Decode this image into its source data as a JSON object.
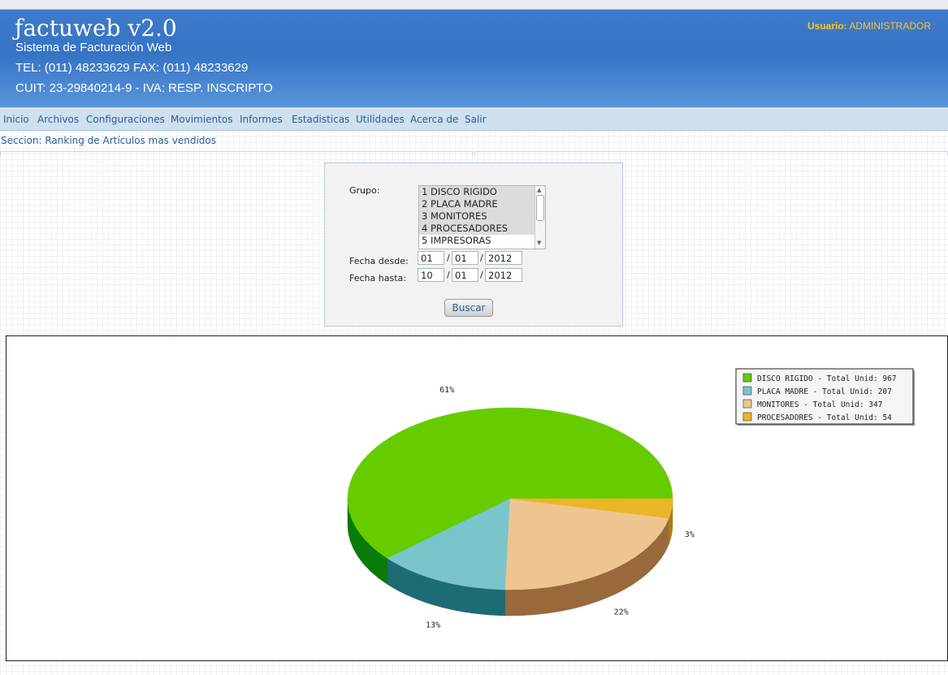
{
  "header": {
    "logo": "ƒactuweb v2.0",
    "subtitle": "Sistema de Facturación Web",
    "phone": "TEL: (011) 48233629 FAX: (011) 48233629",
    "cuit": "CUIT: 23-29840214-9 - IVA: RESP. INSCRIPTO",
    "user_label": "Usuario:",
    "user_name": "ADMINISTRADOR"
  },
  "menu": [
    {
      "label": "Inicio"
    },
    {
      "label": "Archivos"
    },
    {
      "label": "Configuraciones"
    },
    {
      "label": "Movimientos"
    },
    {
      "label": "Informes"
    },
    {
      "label": "Estadisticas"
    },
    {
      "label": "Utilidades"
    },
    {
      "label": "Acerca de"
    },
    {
      "label": "Salir"
    }
  ],
  "section": "Seccion: Ranking de Artículos mas vendidos",
  "form": {
    "grupo_label": "Grupo:",
    "grupo_options": [
      "1 DISCO RIGIDO",
      "2 PLACA MADRE",
      "3 MONITORES",
      "4 PROCESADORES",
      "5 IMPRESORAS"
    ],
    "desde_label": "Fecha desde:",
    "desde": {
      "d": "01",
      "m": "01",
      "y": "2012"
    },
    "hasta_label": "Fecha hasta:",
    "hasta": {
      "d": "10",
      "m": "01",
      "y": "2012"
    },
    "buscar_label": "Buscar",
    "separator": "/"
  },
  "chart_data": {
    "type": "pie",
    "categories": [
      "DISCO RIGIDO",
      "PLACA MADRE",
      "MONITORES",
      "PROCESADORES"
    ],
    "values": [
      967,
      207,
      347,
      54
    ],
    "data_labels": [
      "61%",
      "13%",
      "22%",
      "3%"
    ],
    "legend": [
      "DISCO RIGIDO - Total Unid: 967",
      "PLACA MADRE - Total Unid: 207",
      "MONITORES - Total Unid: 347",
      "PROCESADORES - Total Unid: 54"
    ],
    "colors": [
      "#66cc00",
      "#7ac4cc",
      "#eec591",
      "#eab628"
    ],
    "side_colors": [
      "#0a7a0a",
      "#1d6b73",
      "#98693a",
      "#a97f17"
    ],
    "legend_position": "top-right"
  }
}
